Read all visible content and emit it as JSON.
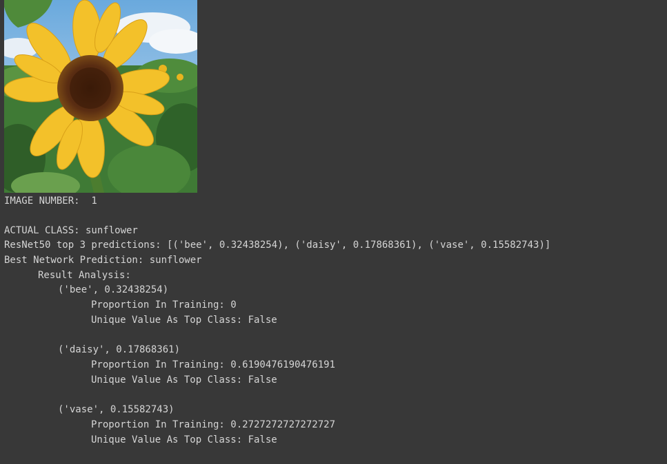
{
  "image": {
    "icon": "sunflower-photo",
    "colors": {
      "sky": "#8fc3ea",
      "petal": "#f3c12a",
      "center": "#5a2d12",
      "leaf": "#3f7a35"
    }
  },
  "output": {
    "image_number": "IMAGE NUMBER:  1",
    "actual_class": "ACTUAL CLASS: sunflower",
    "top3": "ResNet50 top 3 predictions: [('bee', 0.32438254), ('daisy', 0.17868361), ('vase', 0.15582743)]",
    "best_prediction": "Best Network Prediction: sunflower",
    "analysis_header": "Result Analysis:",
    "results": [
      {
        "pred": "('bee', 0.32438254)",
        "proportion": "Proportion In Training: 0",
        "unique": "Unique Value As Top Class: False"
      },
      {
        "pred": "('daisy', 0.17868361)",
        "proportion": "Proportion In Training: 0.6190476190476191",
        "unique": "Unique Value As Top Class: False"
      },
      {
        "pred": "('vase', 0.15582743)",
        "proportion": "Proportion In Training: 0.2727272727272727",
        "unique": "Unique Value As Top Class: False"
      }
    ]
  }
}
